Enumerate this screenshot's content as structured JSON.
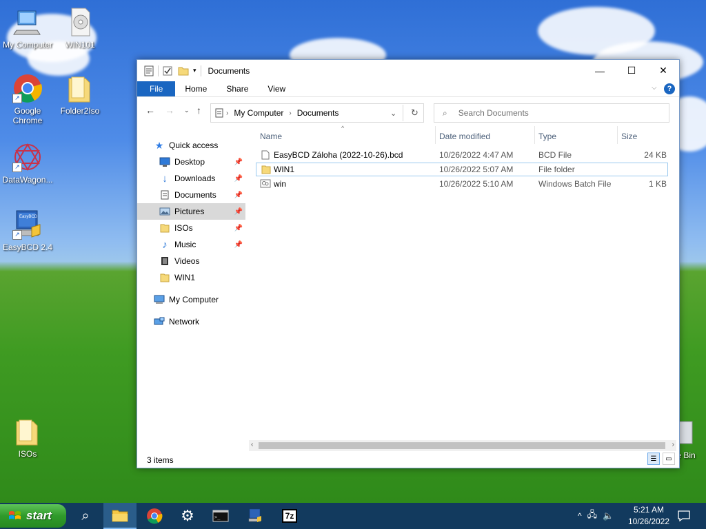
{
  "desktop": {
    "icons": {
      "my_computer": "My Computer",
      "win101": "WIN101",
      "chrome": "Google Chrome",
      "folder2iso": "Folder2Iso",
      "datawagon": "DataWagon...",
      "easybcd": "EasyBCD 2.4",
      "isos": "ISOs",
      "recycle": "e Bin",
      "easybcd_badge": "EasyBCD"
    }
  },
  "window": {
    "title": "Documents",
    "controls": {
      "minimize": "—",
      "maximize": "☐",
      "close": "✕"
    },
    "ribbon_tabs": [
      "File",
      "Home",
      "Share",
      "View"
    ],
    "help": "?",
    "address": {
      "root": "My Computer",
      "current": "Documents"
    },
    "search": {
      "placeholder": "Search Documents"
    },
    "nav_pane": {
      "quick_access": "Quick access",
      "items": [
        "Desktop",
        "Downloads",
        "Documents",
        "Pictures",
        "ISOs",
        "Music",
        "Videos",
        "WIN1"
      ],
      "my_computer": "My Computer",
      "network": "Network"
    },
    "columns": [
      "Name",
      "Date modified",
      "Type",
      "Size"
    ],
    "files": [
      {
        "name": "EasyBCD Záloha (2022-10-26).bcd",
        "date": "10/26/2022 4:47 AM",
        "type": "BCD File",
        "size": "24 KB"
      },
      {
        "name": "WIN1",
        "date": "10/26/2022 5:07 AM",
        "type": "File folder",
        "size": ""
      },
      {
        "name": "win",
        "date": "10/26/2022 5:10 AM",
        "type": "Windows Batch File",
        "size": "1 KB"
      }
    ],
    "status": "3 items"
  },
  "taskbar": {
    "start_label": "start",
    "seven_zip": "7z",
    "clock": {
      "time": "5:21 AM",
      "date": "10/26/2022"
    }
  },
  "colors": {
    "accent": "#1a66c1",
    "selection_border": "#99c9ef",
    "taskbar": "#123a5e",
    "start_green": "#2f9a2a"
  }
}
